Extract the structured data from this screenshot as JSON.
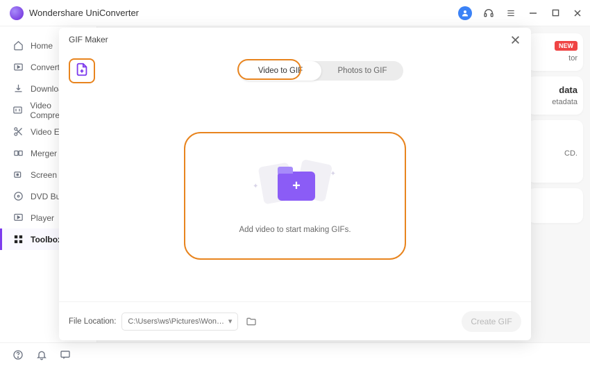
{
  "app": {
    "title": "Wondershare UniConverter"
  },
  "sidebar": {
    "items": [
      {
        "label": "Home"
      },
      {
        "label": "Converter"
      },
      {
        "label": "Downloader"
      },
      {
        "label": "Video Compressor"
      },
      {
        "label": "Video Editor"
      },
      {
        "label": "Merger"
      },
      {
        "label": "Screen Recorder"
      },
      {
        "label": "DVD Burner"
      },
      {
        "label": "Player"
      },
      {
        "label": "Toolbox"
      }
    ]
  },
  "right": {
    "new_badge": "NEW",
    "p1_suffix": "tor",
    "p2_heading": "data",
    "p2_sub": "etadata",
    "p3_text": "CD."
  },
  "modal": {
    "title": "GIF Maker",
    "tabs": {
      "video": "Video to GIF",
      "photos": "Photos to GIF"
    },
    "drop_text": "Add video to start making GIFs.",
    "file_label": "File Location:",
    "file_path": "C:\\Users\\ws\\Pictures\\Wonders",
    "create_label": "Create GIF"
  }
}
